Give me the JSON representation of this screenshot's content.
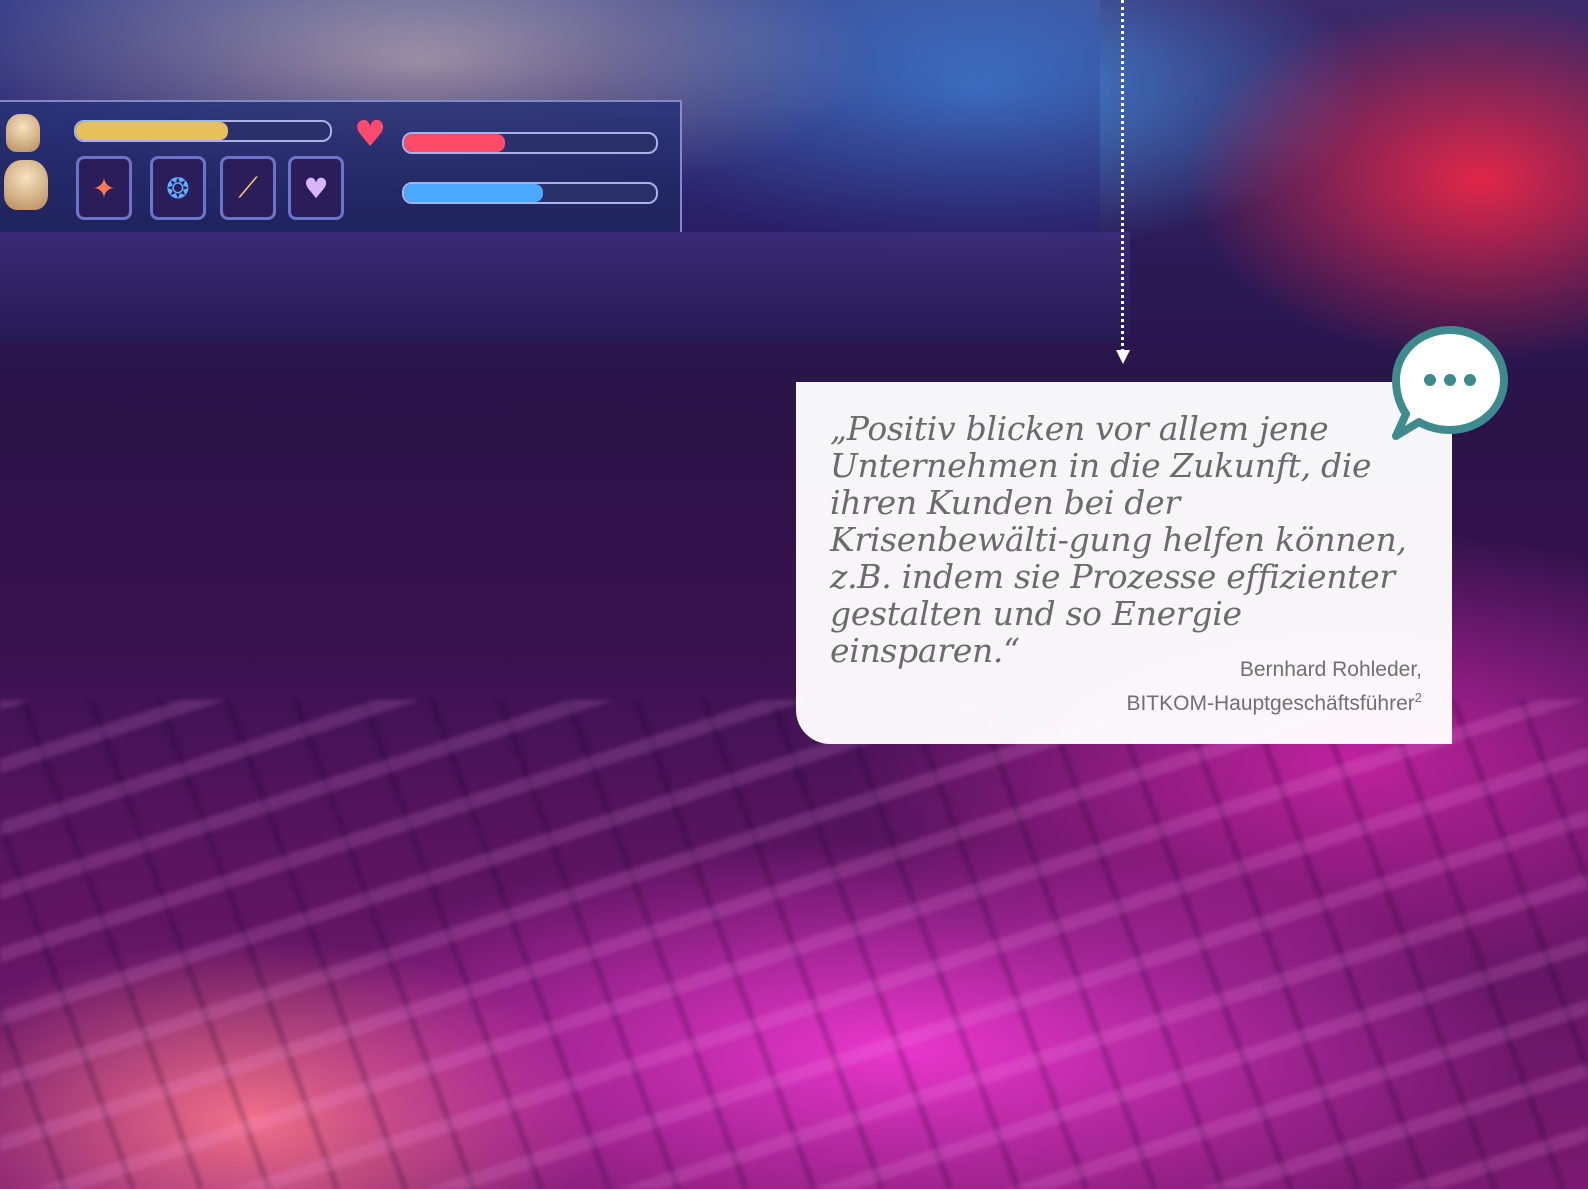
{
  "quote": {
    "text": "„Positiv blicken vor allem jene Unternehmen in die Zukunft, die ihren Kunden bei der Krisenbewälti-gung helfen können, z.B. indem sie Prozesse effizienter gestalten und so Energie einsparen.“",
    "author_name": "Bernhard Rohleder,",
    "author_title": "BITKOM-Hauptgeschäftsführer",
    "footnote": "2"
  },
  "game_hud": {
    "stamina_level": 0.6,
    "health_level": 0.4,
    "mana_level": 0.55
  },
  "colors": {
    "accent_teal": "#3e8a8c",
    "quote_text": "#6b6b6b",
    "card_background": "#ffffff"
  },
  "icons": [
    "speech-bubble-icon",
    "heart-icon",
    "skill-slot-icon"
  ]
}
